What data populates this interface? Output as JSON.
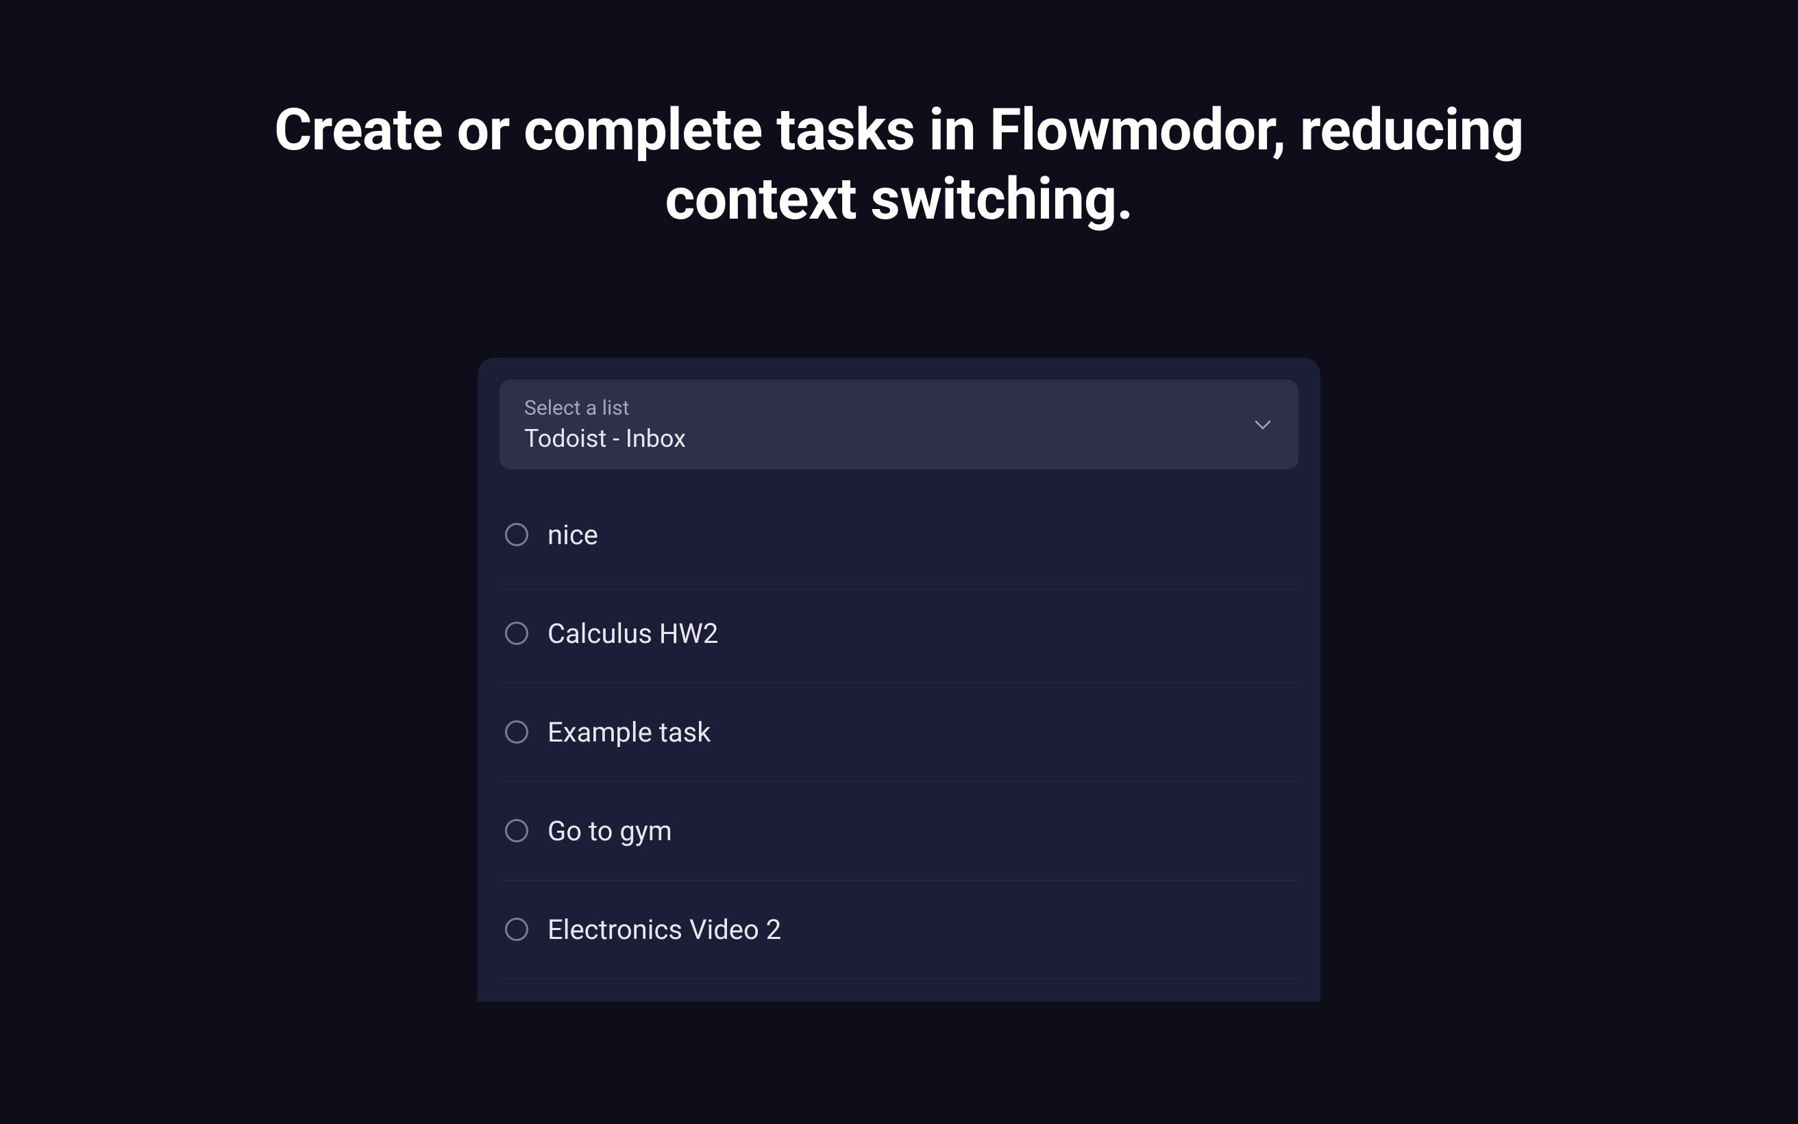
{
  "heading": "Create or complete tasks in Flowmodor, reducing context switching.",
  "listSelector": {
    "label": "Select a list",
    "value": "Todoist - Inbox"
  },
  "tasks": [
    {
      "label": "nice"
    },
    {
      "label": "Calculus HW2"
    },
    {
      "label": "Example task"
    },
    {
      "label": "Go to gym"
    },
    {
      "label": "Electronics Video 2"
    }
  ]
}
